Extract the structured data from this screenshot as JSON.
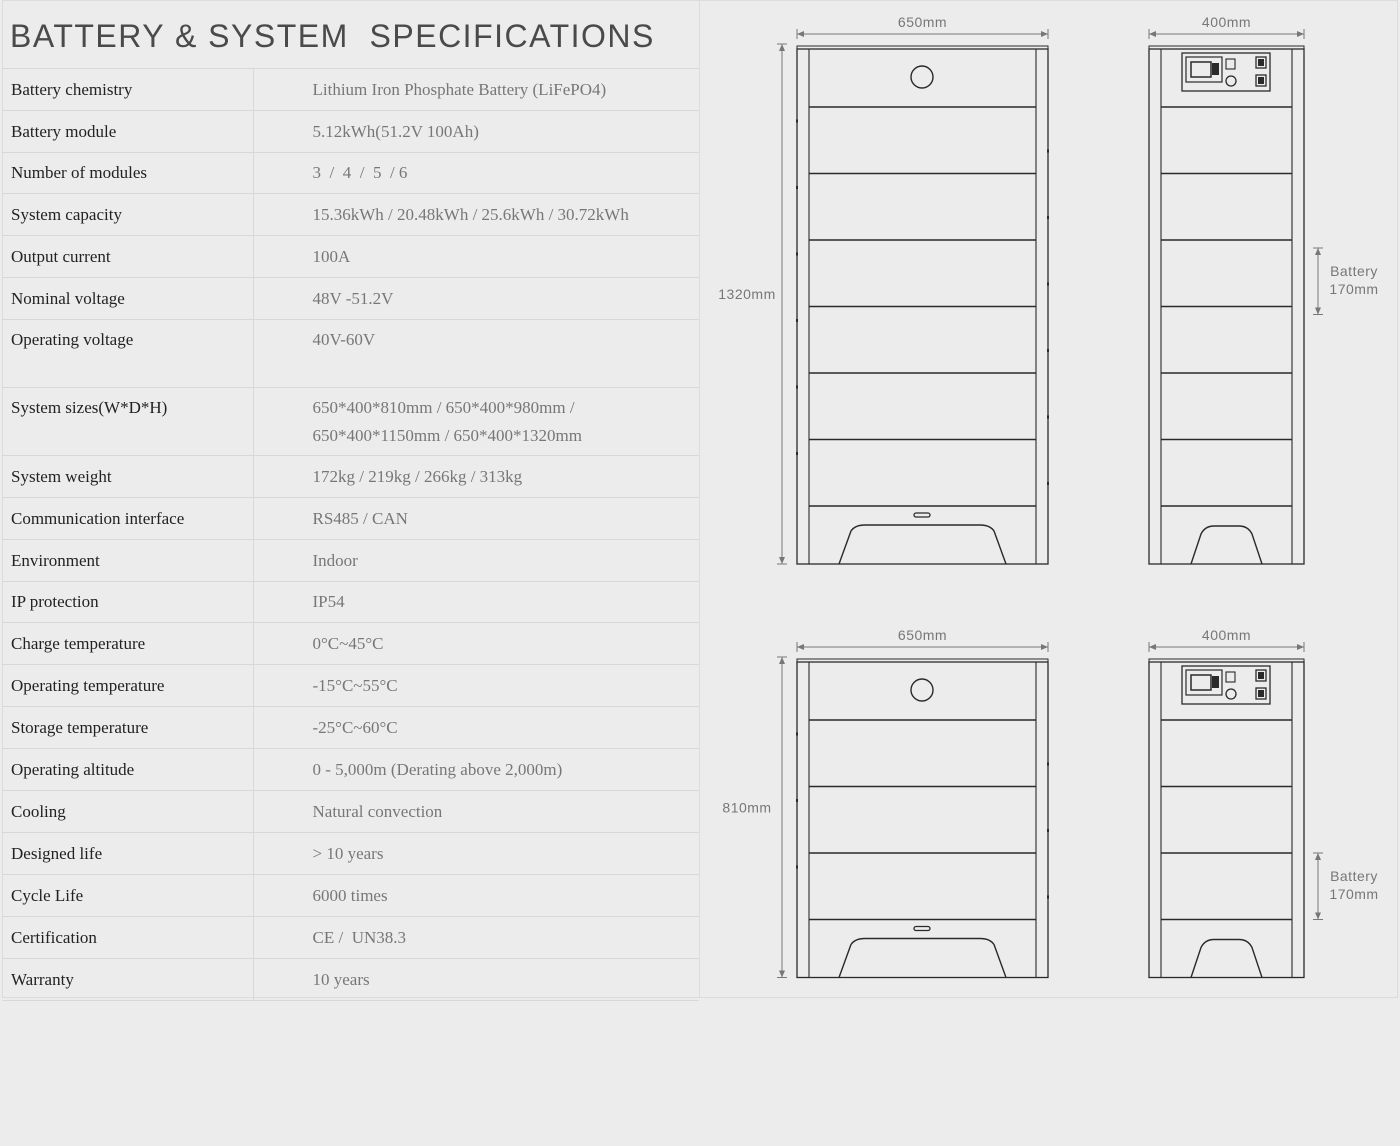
{
  "title": "BATTERY & SYSTEM  SPECIFICATIONS",
  "specs": [
    {
      "label": "Battery chemistry",
      "value": [
        "Lithium Iron Phosphate Battery (LiFePO4)"
      ]
    },
    {
      "label": "Battery module",
      "value": [
        "5.12kWh(51.2V 100Ah)"
      ]
    },
    {
      "label": "Number of modules",
      "value": [
        "3  /  4  /  5  / 6"
      ]
    },
    {
      "label": "System capacity",
      "value": [
        "15.36kWh / 20.48kWh / 25.6kWh / 30.72kWh"
      ]
    },
    {
      "label": "Output current",
      "value": [
        "100A"
      ]
    },
    {
      "label": "Nominal voltage",
      "value": [
        "48V -51.2V"
      ]
    },
    {
      "label": "Operating voltage",
      "value": [
        "40V-60V"
      ]
    },
    {
      "label": "System sizes(W*D*H)",
      "value": [
        "650*400*810mm / 650*400*980mm /",
        "650*400*1150mm / 650*400*1320mm"
      ]
    },
    {
      "label": "System weight",
      "value": [
        "172kg / 219kg / 266kg / 313kg"
      ]
    },
    {
      "label": "Communication interface",
      "value": [
        "RS485 / CAN"
      ]
    },
    {
      "label": "Environment",
      "value": [
        "Indoor"
      ]
    },
    {
      "label": "IP protection",
      "value": [
        "IP54"
      ]
    },
    {
      "label": "Charge temperature",
      "value": [
        "0°C~45°C"
      ]
    },
    {
      "label": "Operating temperature",
      "value": [
        "-15°C~55°C"
      ]
    },
    {
      "label": "Storage temperature",
      "value": [
        "-25°C~60°C"
      ]
    },
    {
      "label": "Operating altitude",
      "value": [
        "0 - 5,000m (Derating above 2,000m)"
      ]
    },
    {
      "label": "Cooling",
      "value": [
        "Natural convection"
      ]
    },
    {
      "label": "Designed life",
      "value": [
        "> 10 years"
      ]
    },
    {
      "label": "Cycle Life",
      "value": [
        "6000 times"
      ]
    },
    {
      "label": "Certification",
      "value": [
        "CE /  UN38.3"
      ]
    },
    {
      "label": "Warranty",
      "value": [
        "10 years"
      ]
    }
  ],
  "drawings": {
    "tall": {
      "front_width": "650mm",
      "side_width": "400mm",
      "height": "1320mm",
      "battery_label": "Battery",
      "battery_height": "170mm",
      "modules": 6
    },
    "short": {
      "front_width": "650mm",
      "side_width": "400mm",
      "height": "810mm",
      "battery_label": "Battery",
      "battery_height": "170mm",
      "modules": 3
    },
    "line_color": "#2a2a2a",
    "dim_color": "#777777"
  }
}
